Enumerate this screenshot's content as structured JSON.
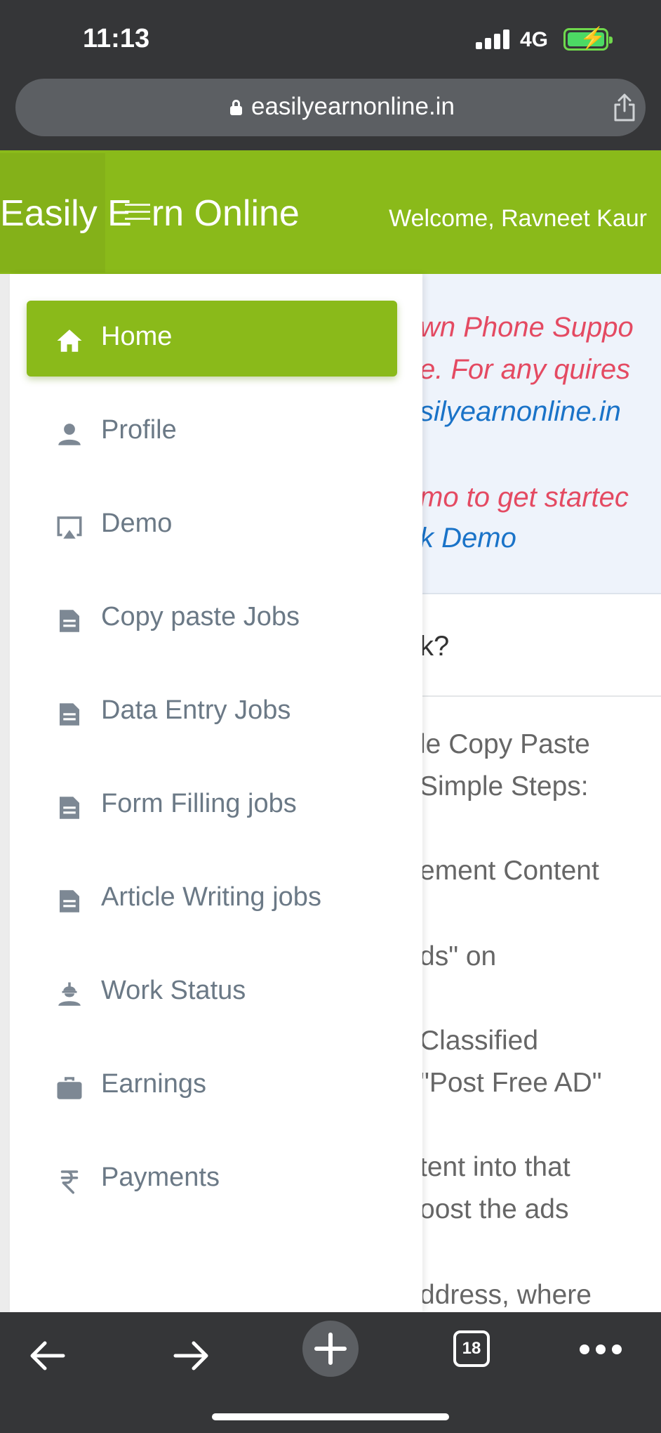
{
  "status_bar": {
    "time": "11:13",
    "network": "4G"
  },
  "browser": {
    "url": "easilyearnonline.in",
    "tabs_count": "18"
  },
  "header": {
    "brand_left": "Easily E",
    "brand_right": "rn Online",
    "welcome": "Welcome, Ravneet Kaur",
    "accent_color": "#8aba1a"
  },
  "page": {
    "notice_lines": [
      "wn Phone Suppo",
      "e. For any quires",
      "silyearnonline.in",
      "mo to get startec",
      "k Demo"
    ],
    "question": "k?",
    "body_lines": [
      "le Copy Paste",
      " Simple Steps:",
      "ement Content",
      "ds\" on",
      "Classified",
      " \"Post Free AD\"",
      "tent into that",
      "oost the ads",
      "ddress, where"
    ]
  },
  "sidebar": {
    "items": [
      {
        "label": "Home",
        "icon": "home-icon",
        "active": true
      },
      {
        "label": "Profile",
        "icon": "person-icon"
      },
      {
        "label": "Demo",
        "icon": "airplay-icon"
      },
      {
        "label": "Copy paste Jobs",
        "icon": "document-icon"
      },
      {
        "label": "Data Entry Jobs",
        "icon": "document-icon"
      },
      {
        "label": "Form Filling jobs",
        "icon": "document-icon"
      },
      {
        "label": "Article Writing jobs",
        "icon": "document-icon"
      },
      {
        "label": "Work Status",
        "icon": "worker-icon"
      },
      {
        "label": "Earnings",
        "icon": "briefcase-icon"
      },
      {
        "label": "Payments",
        "icon": "rupee-icon"
      }
    ]
  }
}
